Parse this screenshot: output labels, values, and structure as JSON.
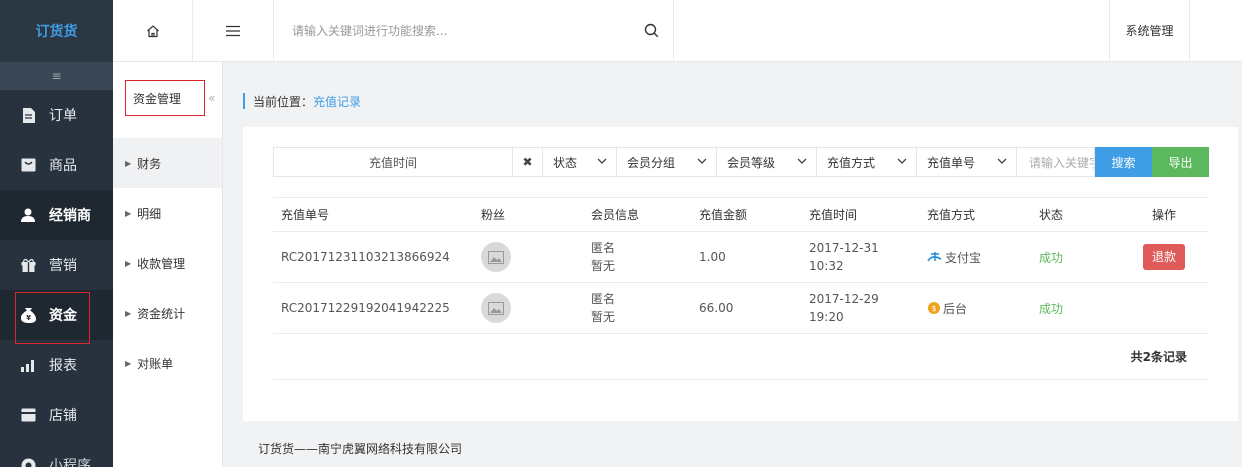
{
  "brand": "订货货",
  "nav": [
    {
      "label": "订单",
      "icon": "document-icon"
    },
    {
      "label": "商品",
      "icon": "box-icon"
    },
    {
      "label": "经销商",
      "icon": "user-icon"
    },
    {
      "label": "营销",
      "icon": "gift-icon"
    },
    {
      "label": "资金",
      "icon": "money-bag-icon"
    },
    {
      "label": "报表",
      "icon": "chart-icon"
    },
    {
      "label": "店铺",
      "icon": "store-icon"
    },
    {
      "label": "小程序",
      "icon": "miniapp-icon"
    }
  ],
  "header": {
    "search_placeholder": "请输入关键词进行功能搜索...",
    "system_label": "系统管理"
  },
  "subnav": {
    "title": "资金管理",
    "items": [
      "财务",
      "明细",
      "收款管理",
      "资金统计",
      "对账单"
    ]
  },
  "breadcrumb": {
    "prefix": "当前位置：",
    "current": "充值记录"
  },
  "filters": {
    "date_label": "充值时间",
    "status": "状态",
    "member_group": "会员分组",
    "member_level": "会员等级",
    "recharge_method": "充值方式",
    "recharge_no": "充值单号",
    "input_placeholder": "请输入关键字",
    "search_label": "搜索",
    "export_label": "导出"
  },
  "table": {
    "headers": [
      "充值单号",
      "粉丝",
      "会员信息",
      "充值金额",
      "充值时间",
      "充值方式",
      "状态",
      "操作"
    ],
    "rows": [
      {
        "no": "RC20171231103213866924",
        "member_name": "匿名",
        "member_extra": "暂无",
        "amount": "1.00",
        "date": "2017-12-31",
        "time": "10:32",
        "method": "支付宝",
        "method_icon": "alipay-icon",
        "status": "成功",
        "action": "退款"
      },
      {
        "no": "RC20171229192041942225",
        "member_name": "匿名",
        "member_extra": "暂无",
        "amount": "66.00",
        "date": "2017-12-29",
        "time": "19:20",
        "method": "后台",
        "method_icon": "coin-icon",
        "status": "成功",
        "action": ""
      }
    ],
    "total": "共2条记录"
  },
  "footer": "订货货——南宁虎翼网络科技有限公司",
  "colors": {
    "accent": "#3f9de6",
    "success": "#5cb85c",
    "danger": "#e05a5a",
    "nav_bg": "#27323e"
  }
}
